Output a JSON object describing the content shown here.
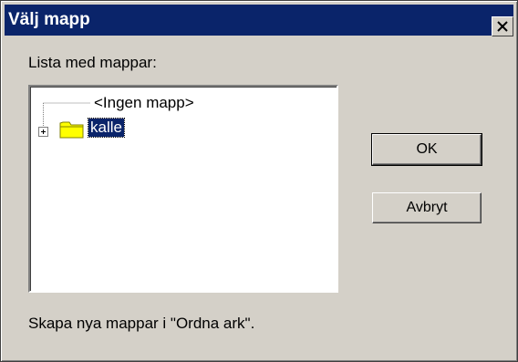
{
  "window": {
    "title": "Välj mapp"
  },
  "titlebar": {
    "close_icon": "close-icon"
  },
  "list": {
    "label": "Lista med mappar:",
    "items": [
      {
        "label": "<Ingen mapp>",
        "selected": false
      },
      {
        "label": "kalle",
        "selected": true,
        "icon": "folder-icon",
        "expandable": true
      }
    ]
  },
  "buttons": {
    "ok_label": "OK",
    "cancel_label": "Avbryt"
  },
  "footer": {
    "note": "Skapa nya mappar i \"Ordna ark\"."
  },
  "colors": {
    "titlebar": "#0a246a",
    "selection": "#0a246a",
    "face": "#d4d0c8"
  }
}
